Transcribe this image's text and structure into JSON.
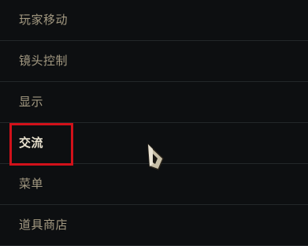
{
  "menu": {
    "items": [
      {
        "label": "玩家移动"
      },
      {
        "label": "镜头控制"
      },
      {
        "label": "显示"
      },
      {
        "label": "交流"
      },
      {
        "label": "菜单"
      },
      {
        "label": "道具商店"
      }
    ],
    "active_index": 3
  },
  "colors": {
    "background": "#0d0f11",
    "text": "#a49a82",
    "active_text": "#e9e2cf",
    "highlight": "#d1111a"
  },
  "icons": {
    "cursor": "arrow-cursor-icon"
  }
}
